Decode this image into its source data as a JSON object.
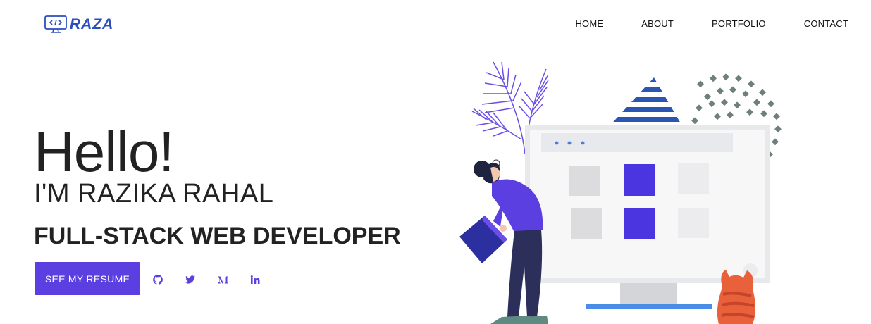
{
  "header": {
    "logo_text": "RAZA",
    "nav": [
      {
        "label": "HOME"
      },
      {
        "label": "ABOUT"
      },
      {
        "label": "PORTFOLIO"
      },
      {
        "label": "CONTACT"
      }
    ]
  },
  "hero": {
    "greeting": "Hello!",
    "name": "I'M RAZIKA RAHAL",
    "role": "FULL-STACK WEB DEVELOPER",
    "resume_button": "SEE MY RESUME"
  },
  "socials": [
    {
      "icon": "github-icon"
    },
    {
      "icon": "twitter-icon"
    },
    {
      "icon": "medium-icon"
    },
    {
      "icon": "linkedin-icon"
    }
  ],
  "colors": {
    "accent": "#5b3fe0",
    "logo": "#2a4fbd",
    "text": "#222222"
  }
}
